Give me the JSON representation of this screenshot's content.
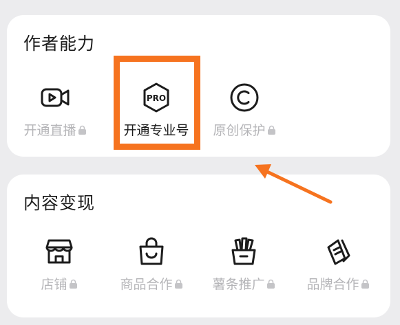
{
  "sections": [
    {
      "title": "作者能力",
      "items": [
        {
          "label": "开通直播",
          "icon": "video-camera-icon",
          "locked": true
        },
        {
          "label": "开通专业号",
          "icon": "pro-badge-icon",
          "locked": false,
          "pro_text": "PRO"
        },
        {
          "label": "原创保护",
          "icon": "copyright-icon",
          "locked": true
        }
      ]
    },
    {
      "title": "内容变现",
      "items": [
        {
          "label": "店铺",
          "icon": "storefront-icon",
          "locked": true
        },
        {
          "label": "商品合作",
          "icon": "shopping-bag-icon",
          "locked": true
        },
        {
          "label": "薯条推广",
          "icon": "fries-icon",
          "locked": true
        },
        {
          "label": "品牌合作",
          "icon": "brand-tag-icon",
          "locked": true
        }
      ]
    }
  ],
  "colors": {
    "highlight": "#f6731f",
    "text_primary": "#1c1c1c",
    "text_disabled": "#b5b5b8",
    "card_bg": "#ffffff",
    "page_bg": "#ececee"
  }
}
